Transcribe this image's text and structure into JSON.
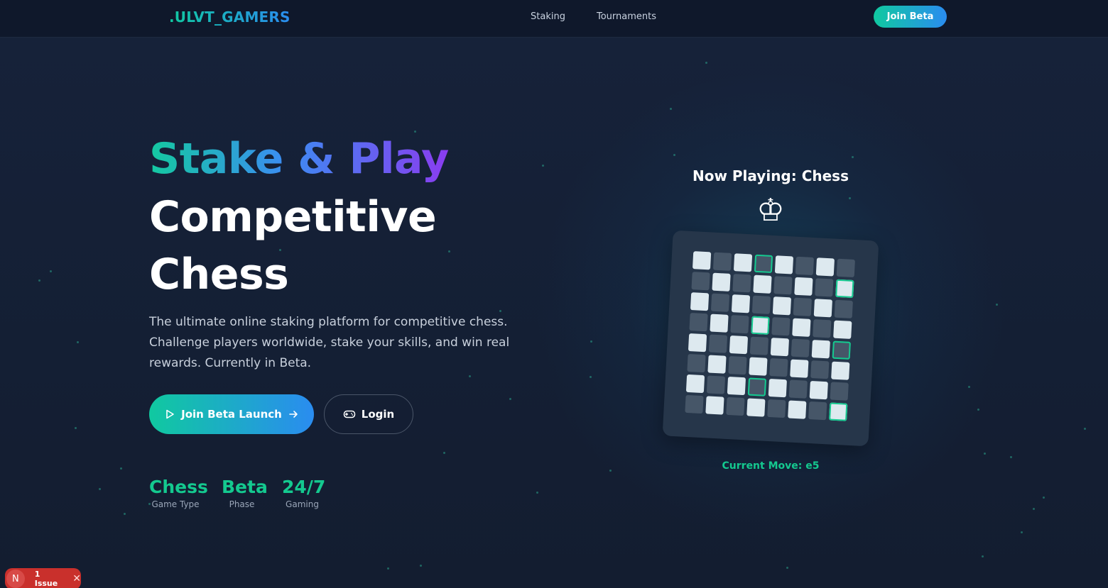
{
  "nav": {
    "logo": ".ULVT_GAMERS",
    "links": [
      "Staking",
      "Tournaments"
    ],
    "cta": "Join Beta"
  },
  "hero": {
    "headline_line1": "Stake & Play",
    "headline_line2": "Competitive",
    "headline_line3": "Chess",
    "description": "The ultimate online staking platform for competitive chess. Challenge players worldwide, stake your skills, and win real rewards. Currently in Beta.",
    "primary_button": "Join Beta Launch",
    "secondary_button": "Login"
  },
  "stats": [
    {
      "value": "Chess",
      "label": "Game Type"
    },
    {
      "value": "Beta",
      "label": "Phase"
    },
    {
      "value": "24/7",
      "label": "Gaming"
    }
  ],
  "panel": {
    "now_playing": "Now Playing: Chess",
    "piece_icon": "chess-king-icon",
    "current_move": "Current Move: e5"
  },
  "board": {
    "size": 8,
    "highlighted": [
      [
        0,
        3
      ],
      [
        1,
        7
      ],
      [
        3,
        3
      ],
      [
        4,
        7
      ],
      [
        6,
        3
      ],
      [
        7,
        7
      ]
    ]
  },
  "issue_badge": {
    "letter": "N",
    "text": "1 Issue"
  },
  "colors": {
    "accent_teal": "#14c98f",
    "accent_blue": "#2a8cf0",
    "accent_purple": "#8a3cf0",
    "background": "#131d30"
  }
}
